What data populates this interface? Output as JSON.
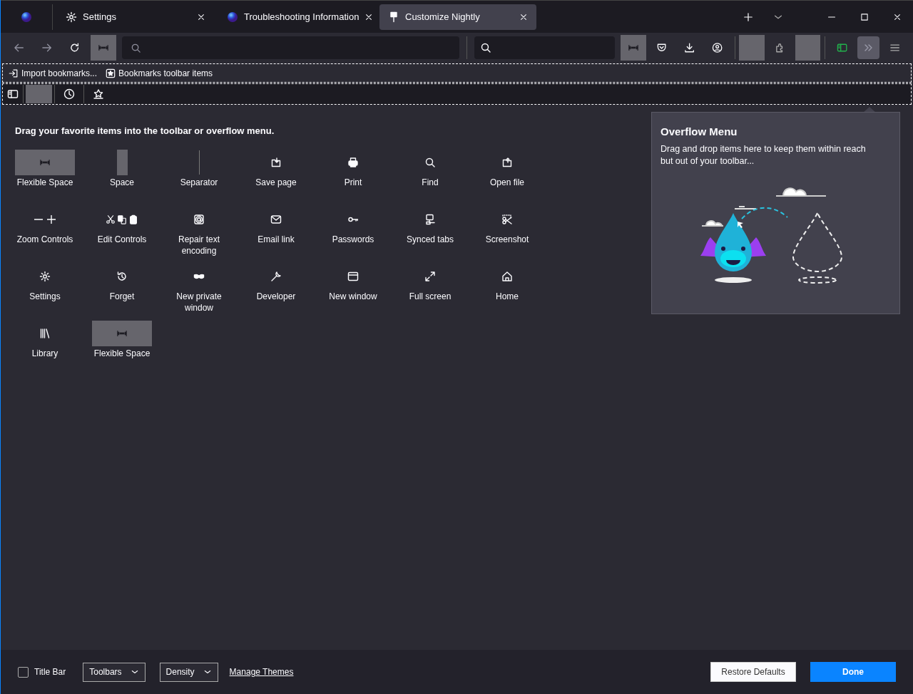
{
  "tabs": [
    {
      "kind": "pinned",
      "selected": false
    },
    {
      "kind": "gear",
      "label": "Settings",
      "selected": false
    },
    {
      "kind": "globe",
      "label": "Troubleshooting Information",
      "selected": false
    },
    {
      "kind": "brush",
      "label": "Customize Nightly",
      "selected": true
    }
  ],
  "bookmarks_toolbar": [
    {
      "kind": "import",
      "label": "Import bookmarks..."
    },
    {
      "kind": "star",
      "label": "Bookmarks toolbar items"
    }
  ],
  "heading": "Drag your favorite items into the toolbar or overflow menu.",
  "palette": [
    {
      "kind": "flexible",
      "label": "Flexible Space"
    },
    {
      "kind": "space",
      "label": "Space"
    },
    {
      "kind": "separator",
      "label": "Separator"
    },
    {
      "kind": "save",
      "label": "Save page"
    },
    {
      "kind": "print",
      "label": "Print"
    },
    {
      "kind": "find",
      "label": "Find"
    },
    {
      "kind": "open",
      "label": "Open file"
    },
    {
      "kind": "zoom",
      "label": "Zoom Controls"
    },
    {
      "kind": "edit",
      "label": "Edit Controls"
    },
    {
      "kind": "encoding",
      "label": "Repair text encoding"
    },
    {
      "kind": "email",
      "label": "Email link"
    },
    {
      "kind": "key",
      "label": "Passwords"
    },
    {
      "kind": "synced",
      "label": "Synced tabs"
    },
    {
      "kind": "screenshot",
      "label": "Screenshot"
    },
    {
      "kind": "gear",
      "label": "Settings"
    },
    {
      "kind": "forget",
      "label": "Forget"
    },
    {
      "kind": "mask",
      "label": "New private window"
    },
    {
      "kind": "wrench",
      "label": "Developer"
    },
    {
      "kind": "window",
      "label": "New window"
    },
    {
      "kind": "fullscreen",
      "label": "Full screen"
    },
    {
      "kind": "home",
      "label": "Home"
    },
    {
      "kind": "library",
      "label": "Library"
    },
    {
      "kind": "flexible",
      "label": "Flexible Space"
    }
  ],
  "overflow_panel": {
    "title": "Overflow Menu",
    "description": "Drag and drop items here to keep them within reach but out of your toolbar..."
  },
  "footer": {
    "title_bar": {
      "label": "Title Bar",
      "checked": false
    },
    "dropdowns": [
      "Toolbars",
      "Density"
    ],
    "link": "Manage Themes",
    "buttons": [
      {
        "kind": "secondary",
        "label": "Restore Defaults"
      },
      {
        "kind": "primary",
        "label": "Done"
      }
    ]
  }
}
